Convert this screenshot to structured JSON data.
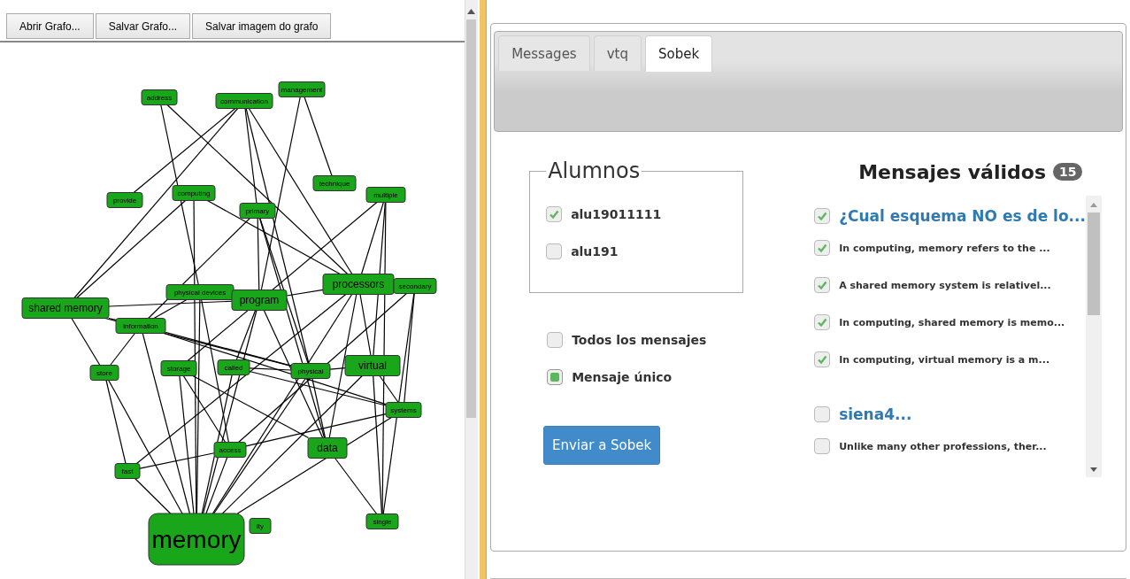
{
  "graph_toolbar": {
    "buttons": [
      "Abrir Grafo...",
      "Salvar Grafo...",
      "Salvar imagem do grafo"
    ]
  },
  "graph": {
    "nodes": [
      {
        "label": "address",
        "kind": "minor"
      },
      {
        "label": "communication",
        "kind": "minor"
      },
      {
        "label": "management",
        "kind": "minor"
      },
      {
        "label": "provide",
        "kind": "minor"
      },
      {
        "label": "computing",
        "kind": "minor"
      },
      {
        "label": "technique",
        "kind": "minor"
      },
      {
        "label": "multiple",
        "kind": "minor"
      },
      {
        "label": "primary",
        "kind": "minor"
      },
      {
        "label": "shared memory",
        "kind": "medium"
      },
      {
        "label": "physical devices",
        "kind": "minor"
      },
      {
        "label": "program",
        "kind": "medium"
      },
      {
        "label": "processors",
        "kind": "medium"
      },
      {
        "label": "secondary",
        "kind": "minor"
      },
      {
        "label": "information",
        "kind": "minor"
      },
      {
        "label": "store",
        "kind": "minor"
      },
      {
        "label": "storage",
        "kind": "minor"
      },
      {
        "label": "called",
        "kind": "minor"
      },
      {
        "label": "physical",
        "kind": "minor"
      },
      {
        "label": "virtual",
        "kind": "medium"
      },
      {
        "label": "systems",
        "kind": "minor"
      },
      {
        "label": "access",
        "kind": "minor"
      },
      {
        "label": "data",
        "kind": "medium"
      },
      {
        "label": "fast",
        "kind": "minor"
      },
      {
        "label": "single",
        "kind": "minor"
      },
      {
        "label": "ity",
        "kind": "minor"
      },
      {
        "label": "memory",
        "kind": "major"
      }
    ]
  },
  "tabs": [
    {
      "label": "Messages",
      "selected": false
    },
    {
      "label": "vtq",
      "selected": false
    },
    {
      "label": "Sobek",
      "selected": true
    }
  ],
  "alumnos": {
    "legend": "Alumnos",
    "students": [
      {
        "name": "alu19011111",
        "checked": true
      },
      {
        "name": "alu191",
        "checked": false
      }
    ]
  },
  "message_mode": [
    {
      "label": "Todos los mensajes",
      "selected": false
    },
    {
      "label": "Mensaje único",
      "selected": true
    }
  ],
  "send_button": "Enviar a Sobek",
  "messages_panel": {
    "title": "Mensajes válidos",
    "count": "15",
    "items": [
      {
        "kind": "heading",
        "text": "¿Cual esquema NO es de lo...",
        "checked": true
      },
      {
        "kind": "item",
        "text": "In computing, memory refers to the ...",
        "checked": true
      },
      {
        "kind": "item",
        "text": "A shared memory system is relativel...",
        "checked": true
      },
      {
        "kind": "item",
        "text": "In computing, shared memory is memo...",
        "checked": true
      },
      {
        "kind": "item",
        "text": "In computing, virtual memory is a m...",
        "checked": true
      },
      {
        "kind": "heading",
        "text": "siena4...",
        "checked": false
      },
      {
        "kind": "item",
        "text": "Unlike many other professions, ther...",
        "checked": false
      }
    ]
  }
}
